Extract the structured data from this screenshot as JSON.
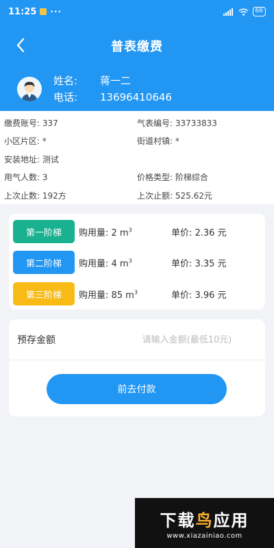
{
  "status": {
    "time": "11:25",
    "more": "···",
    "battery": "66"
  },
  "header": {
    "title": "普表缴费"
  },
  "user": {
    "name_label": "姓名:",
    "name": "蒋一二",
    "phone_label": "电话:",
    "phone": "13696410646"
  },
  "info": [
    {
      "left": "缴费账号: 337",
      "right": "气表编号: 33733833"
    },
    {
      "left": "小区片区: *",
      "right": "街道村镇: *"
    },
    {
      "left": "安装地址: 测试",
      "right": ""
    },
    {
      "left": "用气人数: 3",
      "right": "价格类型: 阶梯综合"
    },
    {
      "left": "上次止数: 192方",
      "right": "上次止额: 525.62元"
    }
  ],
  "tiers": [
    {
      "label": "第一阶梯",
      "amount": "购用量: 2 m",
      "sup": "3",
      "price": "单价: 2.36 元",
      "color": "#19b18f"
    },
    {
      "label": "第二阶梯",
      "amount": "购用量: 4 m",
      "sup": "3",
      "price": "单价: 3.35 元",
      "color": "#2196f3"
    },
    {
      "label": "第三阶梯",
      "amount": "购用量: 85 m",
      "sup": "3",
      "price": "单价: 3.96 元",
      "color": "#f8bb16"
    }
  ],
  "form": {
    "deposit_label": "预存金额",
    "deposit_placeholder": "请输入金额(最低10元)",
    "deposit_value": "",
    "pay_label": "前去付款"
  },
  "watermark": {
    "main_a": "下载",
    "main_b": "鸟",
    "main_c": "应用",
    "url": "www.xiazainiao.com"
  },
  "colors": {
    "primary": "#2196f3",
    "tier1": "#19b18f",
    "tier2": "#2196f3",
    "tier3": "#f8bb16"
  }
}
